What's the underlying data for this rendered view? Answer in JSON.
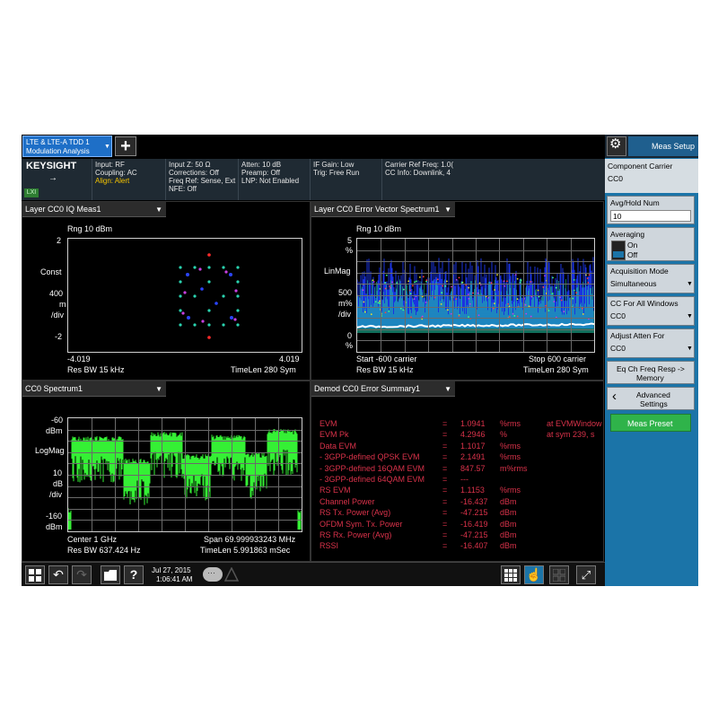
{
  "mode_tab": {
    "line1": "LTE & LTE-A TDD 1",
    "line2": "Modulation Analysis"
  },
  "toolbar": {
    "add_label": "+"
  },
  "brand": {
    "name": "KEYSIGHT",
    "badge": "LXI"
  },
  "info": {
    "col1": [
      "Input: RF",
      "Coupling: AC",
      "Align: Alert"
    ],
    "col2": [
      "Input Z: 50 Ω",
      "Corrections: Off",
      "Freq Ref: Sense, Ext",
      "NFE: Off"
    ],
    "col3": [
      "Atten: 10 dB",
      "Preamp: Off",
      "LNP: Not Enabled"
    ],
    "col4": [
      "IF Gain: Low",
      "Trig: Free Run"
    ],
    "col5": [
      "Carrier Ref Freq: 1.0(",
      "CC Info: Downlink, 4"
    ]
  },
  "panel_iq": {
    "title": "Layer CC0 IQ Meas1",
    "rng": "Rng 10 dBm",
    "y_top": "2",
    "y_mid_labels": [
      "Const",
      "400",
      "m",
      "/div"
    ],
    "y_bottom": "-2",
    "x_left": "-4.019",
    "x_right": "4.019",
    "foot_left": "Res BW 15 kHz",
    "foot_right": "TimeLen 280  Sym"
  },
  "panel_evm": {
    "title": "Layer CC0 Error Vector Spectrum1",
    "rng": "Rng 10 dBm",
    "y_labels": [
      "5",
      "%",
      "LinMag",
      "500",
      "m%",
      "/div",
      "0",
      "%"
    ],
    "x_left": "Start -600  carrier",
    "x_right": "Stop 600  carrier",
    "foot_left": "Res BW 15 kHz",
    "foot_right": "TimeLen 280  Sym"
  },
  "panel_spec": {
    "title": "CC0 Spectrum1",
    "y_labels": [
      "-60",
      "dBm",
      "LogMag",
      "10",
      "dB",
      "/div",
      "-160",
      "dBm"
    ],
    "foot_left1": "Center 1 GHz",
    "foot_right1": "Span 69.999933243 MHz",
    "foot_left2": "Res BW 637.424  Hz",
    "foot_right2": "TimeLen 5.991863 mSec"
  },
  "panel_err": {
    "title": "Demod CC0 Error Summary1",
    "rows": [
      {
        "name": "EVM",
        "eq": "=",
        "value": "1.0941",
        "unit": "%rms",
        "note": "at   EVMWindow"
      },
      {
        "name": "EVM Pk",
        "eq": "=",
        "value": "4.2946",
        "unit": "%",
        "note": "at  sym 239,  s"
      },
      {
        "name": "Data EVM",
        "eq": "=",
        "value": "1.1017",
        "unit": "%rms",
        "note": ""
      },
      {
        "name": " - 3GPP-defined QPSK EVM",
        "eq": "=",
        "value": "2.1491",
        "unit": "%rms",
        "note": ""
      },
      {
        "name": " - 3GPP-defined 16QAM EVM",
        "eq": "=",
        "value": "847.57",
        "unit": "m%rms",
        "note": ""
      },
      {
        "name": " - 3GPP-defined 64QAM EVM",
        "eq": "=",
        "value": "---",
        "unit": "",
        "note": ""
      },
      {
        "name": "RS EVM",
        "eq": "=",
        "value": "1.1153",
        "unit": "%rms",
        "note": ""
      },
      {
        "name": "Channel Power",
        "eq": "=",
        "value": "-16.437",
        "unit": "dBm",
        "note": ""
      },
      {
        "name": "RS Tx. Power (Avg)",
        "eq": "=",
        "value": "-47.215",
        "unit": "dBm",
        "note": ""
      },
      {
        "name": "OFDM Sym. Tx. Power",
        "eq": "=",
        "value": "-16.419",
        "unit": "dBm",
        "note": ""
      },
      {
        "name": "RS Rx. Power (Avg)",
        "eq": "=",
        "value": "-47.215",
        "unit": "dBm",
        "note": ""
      },
      {
        "name": "RSSI",
        "eq": "=",
        "value": "-16.407",
        "unit": "dBm",
        "note": ""
      }
    ]
  },
  "right_panel": {
    "title": "Meas Setup",
    "component_carrier_label": "Component Carrier",
    "component_carrier_value": "CC0",
    "avg_hold_label": "Avg/Hold Num",
    "avg_hold_value": "10",
    "averaging_label": "Averaging",
    "averaging_on": "On",
    "averaging_off": "Off",
    "acq_mode_label": "Acquisition Mode",
    "acq_mode_value": "Simultaneous",
    "cc_all_label": "CC For All Windows",
    "cc_all_value": "CC0",
    "adjust_atten_label": "Adjust Atten For",
    "adjust_atten_value": "CC0",
    "eq_btn_line1": "Eq Ch Freq Resp ->",
    "eq_btn_line2": "Memory",
    "adv_line1": "Advanced",
    "adv_line2": "Settings",
    "preset_label": "Meas Preset"
  },
  "bottom": {
    "date": "Jul 27, 2015",
    "time": "1:06:41 AM"
  },
  "colors": {
    "accent": "#1b74a8",
    "error_text": "#d9324a",
    "trace_green": "#35f035"
  }
}
